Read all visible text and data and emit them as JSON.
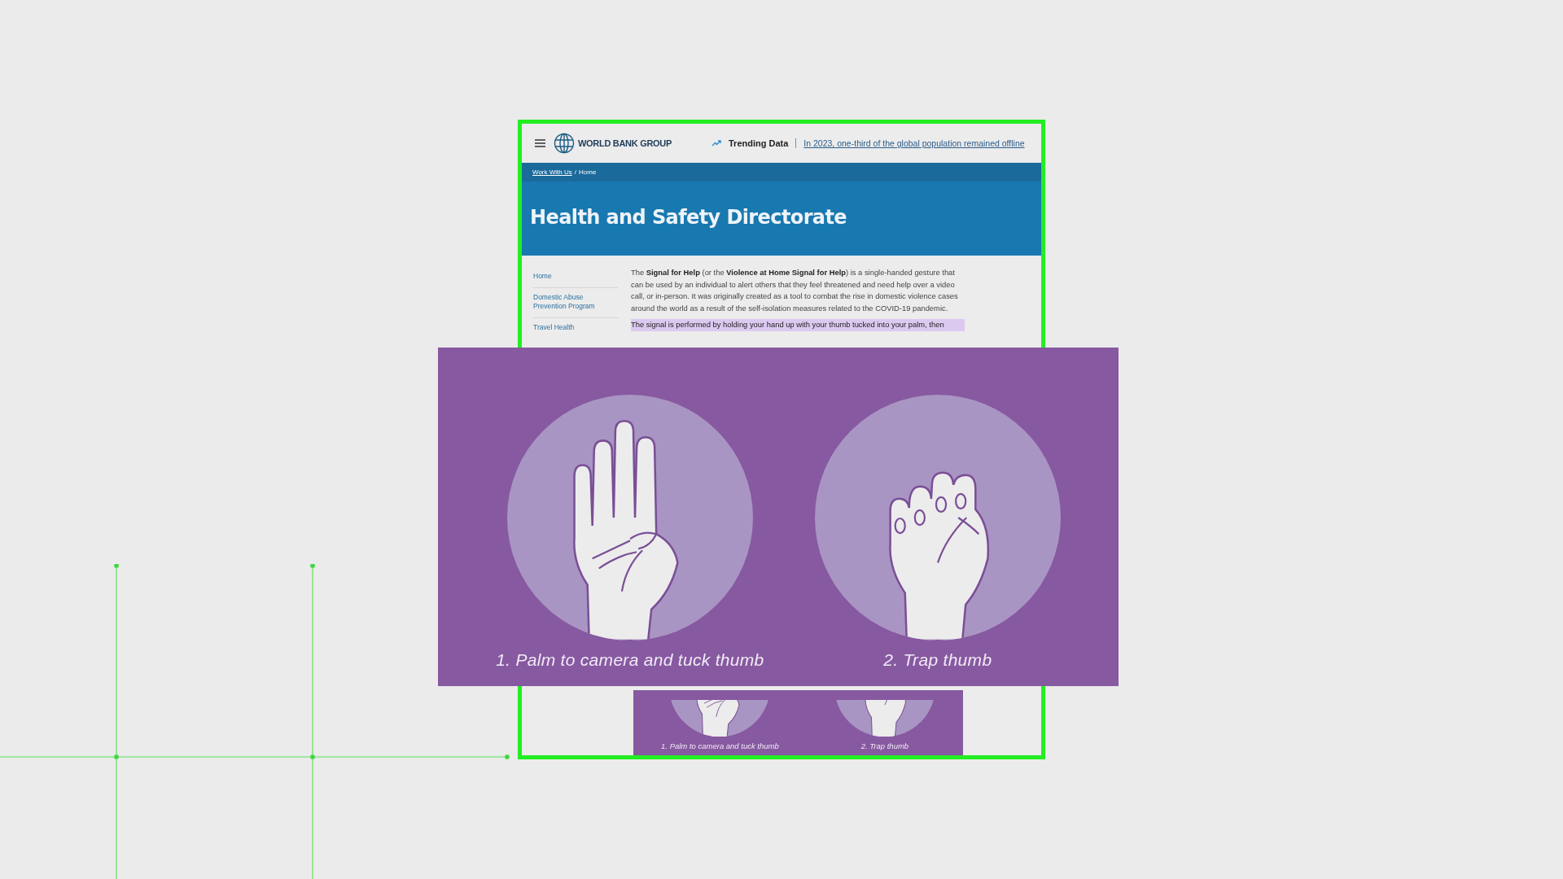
{
  "header": {
    "logo_text": "WORLD BANK GROUP",
    "trending_label": "Trending Data",
    "trending_link": "In 2023, one-third of the global population remained offline"
  },
  "breadcrumb": {
    "items": [
      {
        "label": "Work With Us",
        "link": true
      },
      {
        "label": "Home",
        "link": false
      }
    ],
    "separator": "/"
  },
  "page_title": "Health and Safety Directorate",
  "sidebar": {
    "items": [
      {
        "label": "Home"
      },
      {
        "label": "Domestic Abuse Prevention Program"
      },
      {
        "label": "Travel Health"
      }
    ]
  },
  "paragraphs": [
    {
      "text": "The **Signal for Help** (or the **Violence at Home Signal for Help**) is a single-handed gesture that can be used by an individual to alert others that they feel threatened and need help over a video call, or in-person. It was originally created as a tool to combat the rise in domestic violence cases around the world as a result of the self-isolation measures related to the COVID-19 pandemic.",
      "highlighted": false
    },
    {
      "text": "The signal is performed by holding your hand up with your thumb tucked into your palm, then",
      "highlighted": true
    }
  ],
  "inline_graphic": {
    "steps": [
      {
        "kind": "open-hand",
        "caption": "1. Palm to camera and tuck thumb"
      },
      {
        "kind": "fist",
        "caption": "2. Trap thumb"
      }
    ]
  },
  "overlay_graphic": {
    "steps": [
      {
        "kind": "open-hand",
        "caption": "1. Palm to camera and tuck thumb"
      },
      {
        "kind": "fist",
        "caption": "2. Trap thumb"
      }
    ]
  }
}
